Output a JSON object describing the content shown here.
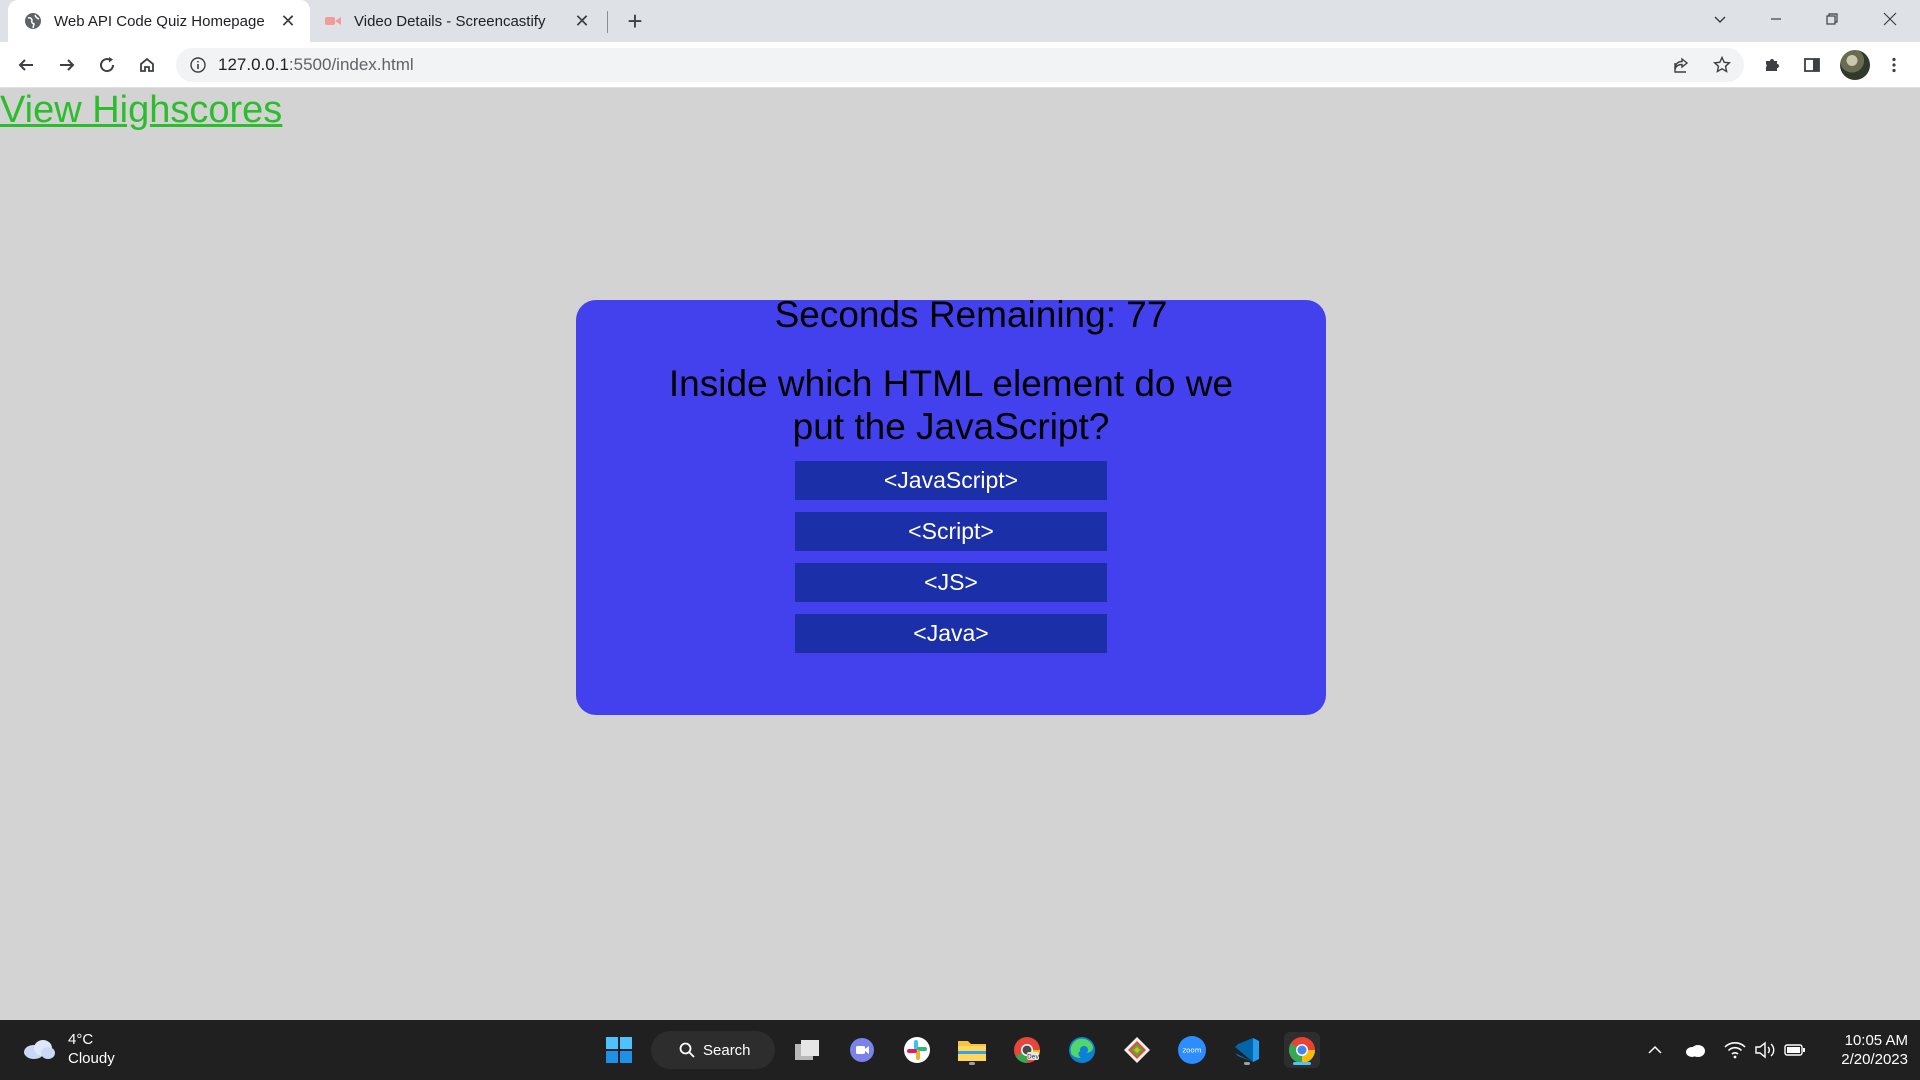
{
  "browser": {
    "tabs": [
      {
        "title": "Web API Code Quiz Homepage",
        "active": true,
        "icon": "globe-icon"
      },
      {
        "title": "Video Details - Screencastify",
        "active": false,
        "icon": "screencastify-icon"
      }
    ],
    "url": {
      "host": "127.0.0.1",
      "path": ":5500/index.html"
    }
  },
  "page": {
    "highscores_link": "View Highscores",
    "timer": {
      "label": "Seconds Remaining: ",
      "value": "77"
    },
    "question": "Inside which HTML element do we put the JavaScript?",
    "answers": [
      "<JavaScript>",
      "<Script>",
      "<JS>",
      "<Java>"
    ]
  },
  "colors": {
    "page_background": "#d3d3d3",
    "card_background": "#4340ee",
    "answer_button": "#1a2fa8",
    "link": "#2bbd2b"
  },
  "taskbar": {
    "weather": {
      "temp": "4°C",
      "condition": "Cloudy"
    },
    "search_label": "Search",
    "clock": {
      "time": "10:05 AM",
      "date": "2/20/2023"
    },
    "pinned": [
      "start-icon",
      "task-view-icon",
      "teams-chat-icon",
      "slack-icon",
      "file-explorer-icon",
      "chrome-dev-icon",
      "edge-icon",
      "git-icon",
      "zoom-icon",
      "vscode-icon",
      "chrome-icon"
    ]
  }
}
